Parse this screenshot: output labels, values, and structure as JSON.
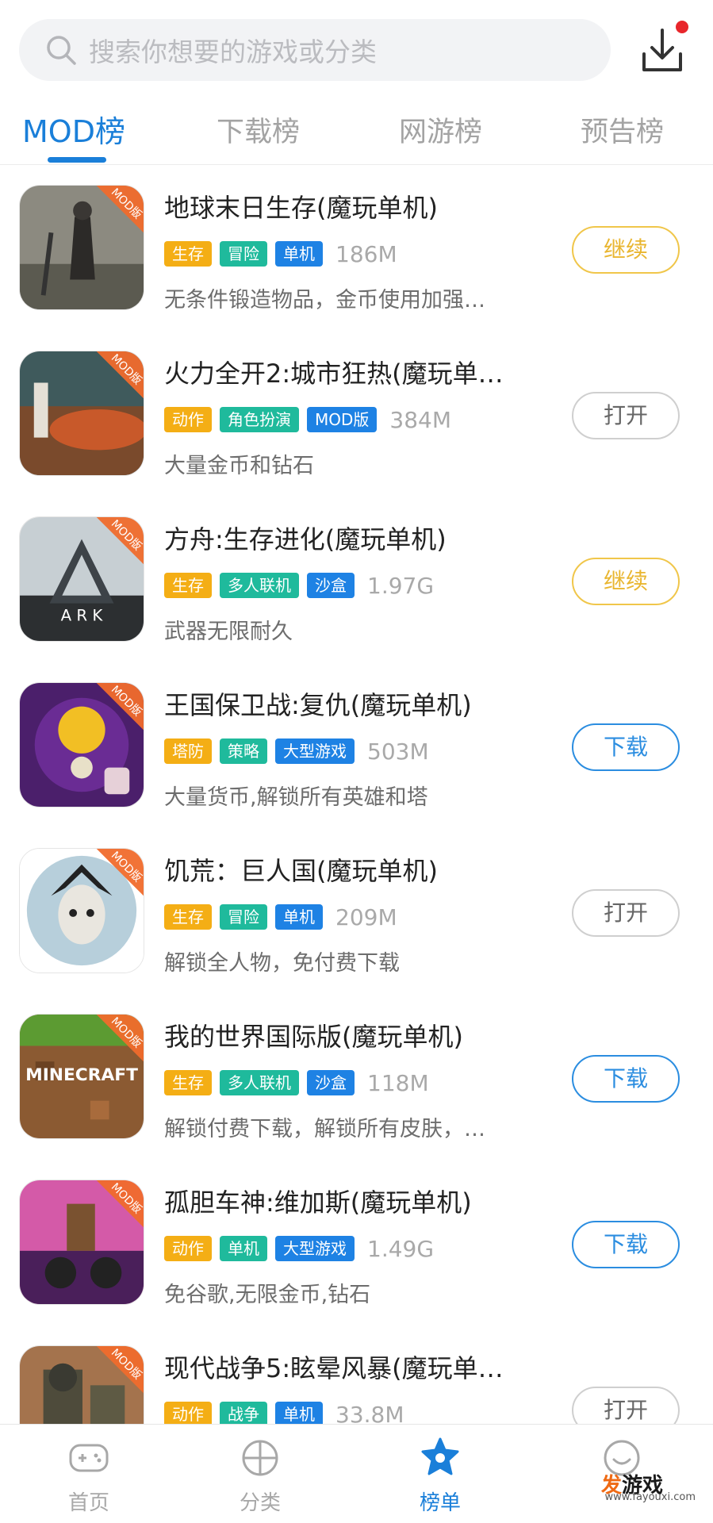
{
  "search": {
    "placeholder": "搜索你想要的游戏或分类"
  },
  "tabs": [
    {
      "label": "MOD榜",
      "active": true
    },
    {
      "label": "下载榜",
      "active": false
    },
    {
      "label": "网游榜",
      "active": false
    },
    {
      "label": "预告榜",
      "active": false
    }
  ],
  "badge_text": "MOD版",
  "tag_colors": {
    "orange": "#f4ae15",
    "teal": "#1fba9c",
    "blue": "#1e82e4"
  },
  "games": [
    {
      "title": "地球末日生存(魔玩单机)",
      "tags": [
        {
          "text": "生存",
          "color": "orange"
        },
        {
          "text": "冒险",
          "color": "teal"
        },
        {
          "text": "单机",
          "color": "blue"
        }
      ],
      "size": "186M",
      "desc": "无条件锻造物品，金币使用加强…",
      "action": "继续"
    },
    {
      "title": "火力全开2:城市狂热(魔玩单…",
      "tags": [
        {
          "text": "动作",
          "color": "orange"
        },
        {
          "text": "角色扮演",
          "color": "teal"
        },
        {
          "text": "MOD版",
          "color": "blue"
        }
      ],
      "size": "384M",
      "desc": "大量金币和钻石",
      "action": "打开"
    },
    {
      "title": "方舟:生存进化(魔玩单机)",
      "tags": [
        {
          "text": "生存",
          "color": "orange"
        },
        {
          "text": "多人联机",
          "color": "teal"
        },
        {
          "text": "沙盒",
          "color": "blue"
        }
      ],
      "size": "1.97G",
      "desc": "武器无限耐久",
      "action": "继续"
    },
    {
      "title": "王国保卫战:复仇(魔玩单机)",
      "tags": [
        {
          "text": "塔防",
          "color": "orange"
        },
        {
          "text": "策略",
          "color": "teal"
        },
        {
          "text": "大型游戏",
          "color": "blue"
        }
      ],
      "size": "503M",
      "desc": "大量货币,解锁所有英雄和塔",
      "action": "下载"
    },
    {
      "title": "饥荒：巨人国(魔玩单机)",
      "tags": [
        {
          "text": "生存",
          "color": "orange"
        },
        {
          "text": "冒险",
          "color": "teal"
        },
        {
          "text": "单机",
          "color": "blue"
        }
      ],
      "size": "209M",
      "desc": "解锁全人物，免付费下载",
      "action": "打开"
    },
    {
      "title": "我的世界国际版(魔玩单机)",
      "tags": [
        {
          "text": "生存",
          "color": "orange"
        },
        {
          "text": "多人联机",
          "color": "teal"
        },
        {
          "text": "沙盒",
          "color": "blue"
        }
      ],
      "size": "118M",
      "desc": "解锁付费下载，解锁所有皮肤，…",
      "action": "下载"
    },
    {
      "title": "孤胆车神:维加斯(魔玩单机)",
      "tags": [
        {
          "text": "动作",
          "color": "orange"
        },
        {
          "text": "单机",
          "color": "teal"
        },
        {
          "text": "大型游戏",
          "color": "blue"
        }
      ],
      "size": "1.49G",
      "desc": "免谷歌,无限金币,钻石",
      "action": "下载"
    },
    {
      "title": "现代战争5:眩晕风暴(魔玩单…",
      "tags": [
        {
          "text": "动作",
          "color": "orange"
        },
        {
          "text": "战争",
          "color": "teal"
        },
        {
          "text": "单机",
          "color": "blue"
        }
      ],
      "size": "33.8M",
      "desc": "",
      "action": "打开"
    }
  ],
  "nav": [
    {
      "label": "首页",
      "icon": "gamepad-icon",
      "active": false
    },
    {
      "label": "分类",
      "icon": "category-icon",
      "active": false
    },
    {
      "label": "榜单",
      "icon": "ranking-icon",
      "active": true
    },
    {
      "label": "",
      "icon": "smile-icon",
      "active": false
    }
  ],
  "watermark": {
    "logo_a": "发",
    "logo_b": "游戏",
    "url": "www.fayouxi.com"
  }
}
